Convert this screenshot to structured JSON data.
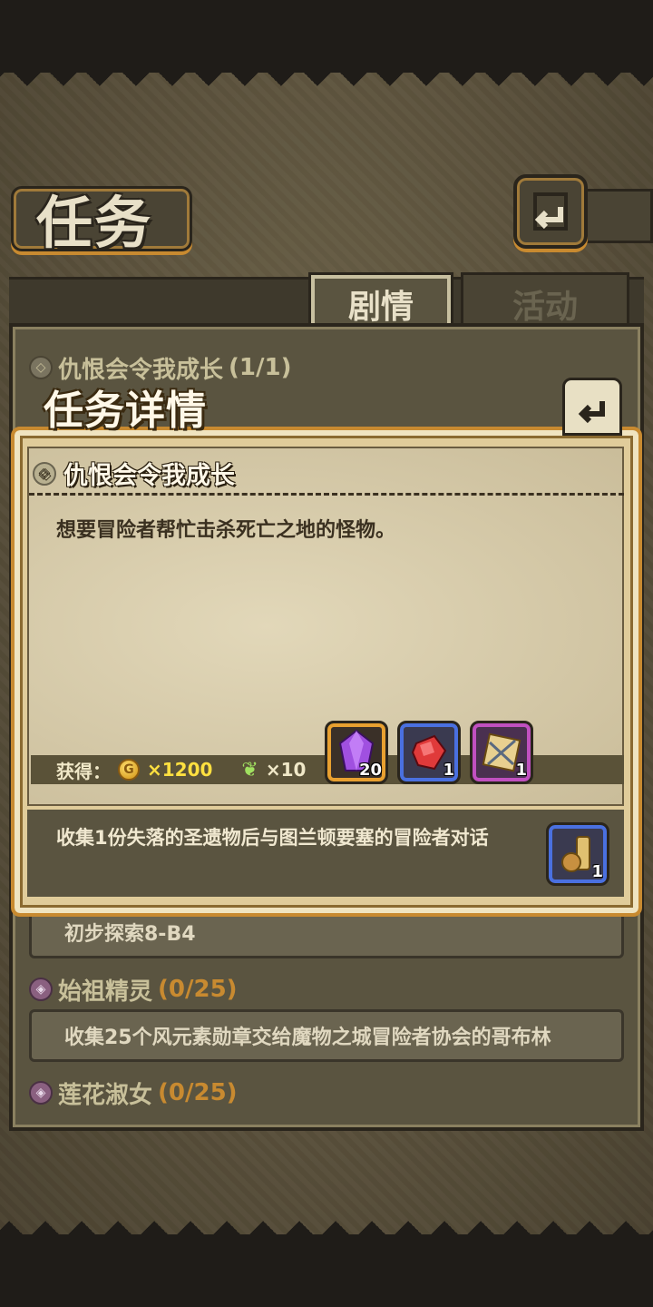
{
  "header": {
    "title": "任务"
  },
  "tabs": [
    {
      "label": "剧情",
      "active": true
    },
    {
      "label": "活动",
      "active": false
    }
  ],
  "quest_list": [
    {
      "name": "仇恨会令我成长",
      "progress": "(1/1)",
      "desc": ""
    },
    {
      "name": "",
      "progress": "",
      "desc": "初步探索8-B4"
    },
    {
      "name": "始祖精灵",
      "progress": "(0/25)",
      "desc": "收集25个风元素勋章交给魔物之城冒险者协会的哥布林"
    },
    {
      "name": "莲花淑女",
      "progress": "(0/25)",
      "desc": ""
    }
  ],
  "detail": {
    "title": "任务详情",
    "quest_name": "仇恨会令我成长",
    "description": "想要冒险者帮忙击杀死亡之地的怪物。",
    "reward_label": "获得：",
    "gold_amount": "×1200",
    "feather_amount": "×10",
    "reward_items": [
      {
        "icon": "purple-crystal-icon",
        "count": "20",
        "frame_color": "#e8a030"
      },
      {
        "icon": "red-gem-icon",
        "count": "1",
        "frame_color": "#4a70e0"
      },
      {
        "icon": "map-scroll-icon",
        "count": "1",
        "frame_color": "#c050c0"
      }
    ],
    "next_step": "收集1份失落的圣遗物后与图兰顿要塞的冒险者对话",
    "next_item": {
      "icon": "relic-icon",
      "count": "1"
    }
  },
  "colors": {
    "accent": "#c88a30",
    "gold_text": "#ffe040",
    "panel": "#5a5440",
    "parchment": "#d8ccaa"
  }
}
